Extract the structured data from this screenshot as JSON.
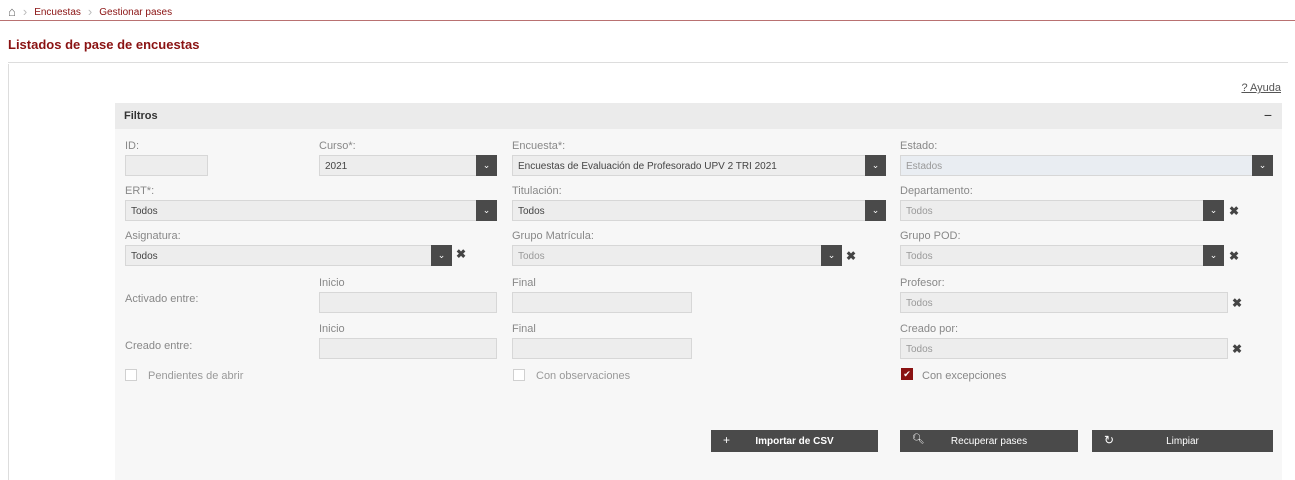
{
  "breadcrumb": {
    "items": [
      "Encuestas",
      "Gestionar pases"
    ]
  },
  "page_title": "Listados de pase de encuestas",
  "help": "? Ayuda",
  "panel": {
    "title": "Filtros",
    "collapse": "−"
  },
  "fields": {
    "id": {
      "label": "ID:",
      "value": ""
    },
    "curso": {
      "label": "Curso*:",
      "value": "2021"
    },
    "encuesta": {
      "label": "Encuesta*:",
      "value": "Encuestas de Evaluación de Profesorado UPV 2 TRI 2021"
    },
    "estado": {
      "label": "Estado:",
      "value": "Estados"
    },
    "ert": {
      "label": "ERT*:",
      "value": "Todos"
    },
    "titulacion": {
      "label": "Titulación:",
      "value": "Todos"
    },
    "departamento": {
      "label": "Departamento:",
      "value": "Todos"
    },
    "asignatura": {
      "label": "Asignatura:",
      "value": "Todos"
    },
    "grupo_matricula": {
      "label": "Grupo Matrícula:",
      "value": "Todos"
    },
    "grupo_pod": {
      "label": "Grupo POD:",
      "value": "Todos"
    },
    "activado": {
      "label": "Activado entre:",
      "inicio": "Inicio",
      "final": "Final"
    },
    "profesor": {
      "label": "Profesor:",
      "value": "Todos"
    },
    "creado": {
      "label": "Creado entre:",
      "inicio": "Inicio",
      "final": "Final"
    },
    "creado_por": {
      "label": "Creado por:",
      "value": "Todos"
    }
  },
  "checkboxes": {
    "pendientes": {
      "label": "Pendientes de abrir",
      "checked": false
    },
    "observaciones": {
      "label": "Con observaciones",
      "checked": false
    },
    "excepciones": {
      "label": "Con excepciones",
      "checked": true
    }
  },
  "buttons": {
    "importar": "Importar de CSV",
    "recuperar": "Recuperar pases",
    "limpiar": "Limpiar"
  },
  "colors": {
    "accent": "#8a1212",
    "button": "#4a4a4a"
  }
}
